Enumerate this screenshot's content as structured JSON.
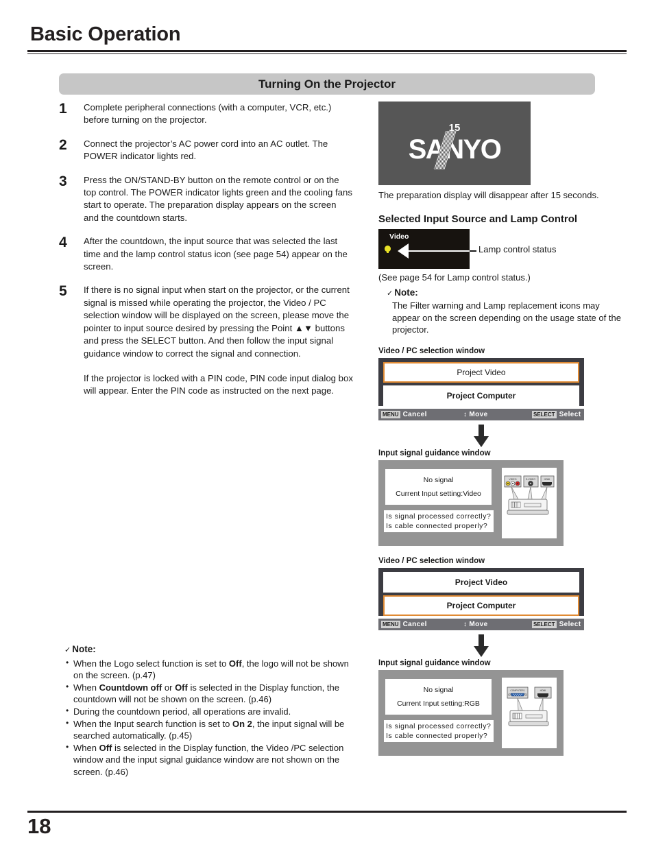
{
  "header": {
    "title": "Basic Operation",
    "banner": "Turning On the Projector"
  },
  "steps": [
    {
      "num": "1",
      "text": "Complete peripheral connections (with a computer, VCR, etc.) before turning on the projector."
    },
    {
      "num": "2",
      "text": "Connect the projector’s AC power cord into an AC outlet. The POWER indicator lights red."
    },
    {
      "num": "3",
      "text": "Press the ON/STAND-BY button on the remote control or on the top control. The POWER indicator lights green and the cooling fans start to operate. The preparation display appears on the screen and the countdown starts."
    },
    {
      "num": "4",
      "text": "After the countdown, the input source that was selected the last time and the lamp control status icon (see page 54) appear on the screen."
    },
    {
      "num": "5",
      "text": "If there is no signal input when start on the projector, or the current signal is missed while operating the projector, the Video / PC selection window will be displayed on the screen, please move the pointer to input source desired by pressing the Point ▲▼ buttons and press the SELECT button. And then follow the input signal guidance window to correct the signal and connection.",
      "text2": "If the projector is locked with a PIN code, PIN code input dialog box will appear. Enter the PIN code as instructed on the next page."
    }
  ],
  "left_note": {
    "heading": "Note:",
    "check": "✓",
    "items": [
      "When the Logo select function is set to <b>Off</b>, the logo will not be shown on the screen.  (p.47)",
      "When <b>Countdown off</b> or <b>Off</b> is selected in the Display function, the countdown will not be shown on the screen. (p.46)",
      "During the countdown period, all operations are invalid.",
      "When the Input search function is set to <b>On 2</b>, the input signal will be searched automatically.  (p.45)",
      "When <b>Off</b> is selected in the Display function, the Video /PC selection window and the input signal guidance window are not shown on the screen.  (p.46)"
    ]
  },
  "logo_screen": {
    "countdown": "15",
    "brand": "SANYO",
    "caption": "The preparation display will disappear after 15 seconds."
  },
  "lamp_section": {
    "heading": "Selected Input Source and Lamp Control",
    "input_label": "Video",
    "callout": "Lamp control status",
    "see_page": "(See page 54 for Lamp control status.)",
    "note_heading": "Note:",
    "note_check": "✓",
    "note_body": "The Filter warning and Lamp replacement icons may appear on the screen depending on the usage state of the projector."
  },
  "selection_window_1": {
    "caption": "Video / PC selection window",
    "items": [
      {
        "label": "Project Video",
        "selected": true,
        "bold": false
      },
      {
        "label": "Project Computer",
        "selected": false,
        "bold": true
      }
    ],
    "bar": {
      "menu_key": "MENU",
      "cancel": "Cancel",
      "move_glyph": "↕",
      "move": "Move",
      "select_key": "SELECT",
      "select": "Select"
    }
  },
  "guidance_window_1": {
    "caption": "Input signal guidance window",
    "line1": "No signal",
    "line2": "Current Input setting:Video",
    "q1": "Is signal processed correctly?",
    "q2": "Is cable connected properly?",
    "connectors": [
      "VIDEO",
      "S-VIDEO",
      "HDMI"
    ]
  },
  "selection_window_2": {
    "caption": "Video / PC selection window",
    "items": [
      {
        "label": "Project Video",
        "selected": false,
        "bold": true
      },
      {
        "label": "Project Computer",
        "selected": true,
        "bold": true
      }
    ],
    "bar": {
      "menu_key": "MENU",
      "cancel": "Cancel",
      "move_glyph": "↕",
      "move": "Move",
      "select_key": "SELECT",
      "select": "Select"
    }
  },
  "guidance_window_2": {
    "caption": "Input signal guidance window",
    "line1": "No signal",
    "line2": "Current Input setting:RGB",
    "q1": "Is signal processed correctly?",
    "q2": "Is cable connected properly?",
    "connectors": [
      "COMPUTER1",
      "HDMI"
    ]
  },
  "footer": {
    "page_number": "18"
  },
  "colors": {
    "banner_bg": "#c6c6c6",
    "osd_bg": "#3c3c42",
    "highlight": "#e08a33",
    "lamp_yellow": "#e8e127",
    "screen_gray": "#565656",
    "guide_gray": "#949494"
  }
}
